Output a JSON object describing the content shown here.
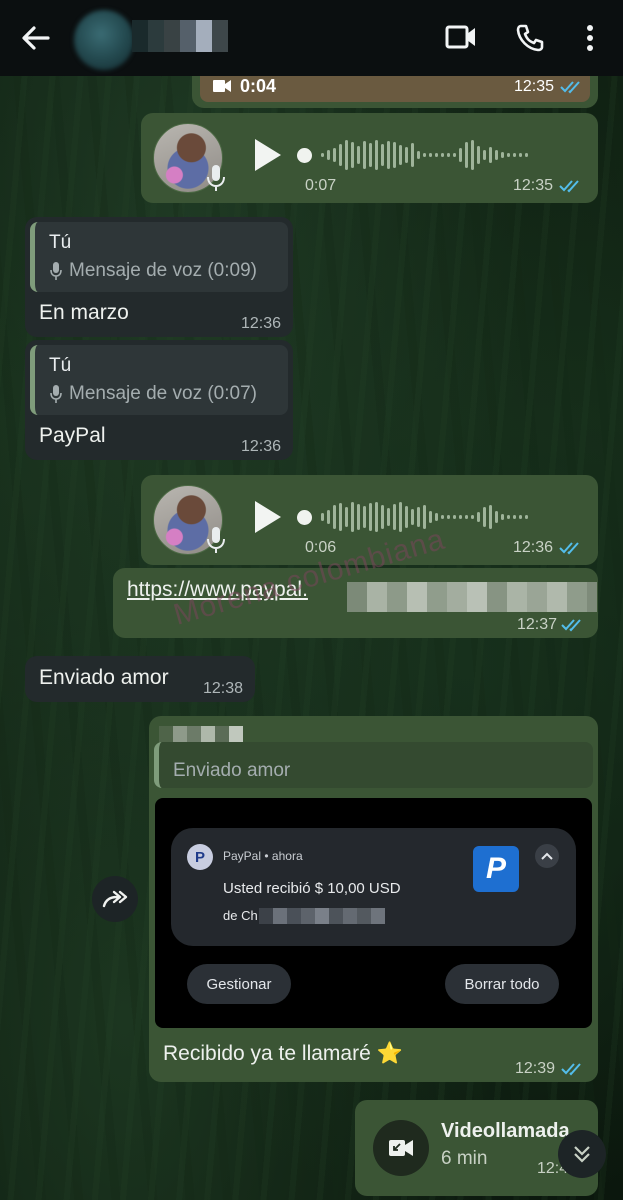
{
  "colors": {
    "outgoing_bubble": "#3b5535",
    "incoming_bubble": "#232a2c",
    "header_bg": "#0b0f10",
    "read_ticks": "#53bdeb"
  },
  "header": {
    "back_icon": "arrow-left-icon",
    "video_call_icon": "videocam-icon",
    "voice_call_icon": "phone-icon",
    "menu_icon": "more-vertical-icon"
  },
  "messages": {
    "video_clip": {
      "duration": "0:04",
      "time": "12:35"
    },
    "voice1": {
      "duration": "0:07",
      "time": "12:35"
    },
    "reply1": {
      "quote_author": "Tú",
      "quote_body": "Mensaje de voz (0:09)",
      "text": "En marzo",
      "time": "12:36"
    },
    "reply2": {
      "quote_author": "Tú",
      "quote_body": "Mensaje de voz (0:07)",
      "text": "PayPal",
      "time": "12:36"
    },
    "voice2": {
      "duration": "0:06",
      "time": "12:36"
    },
    "link": {
      "text": "https://www.paypal.",
      "time": "12:37"
    },
    "in_text": {
      "text": "Enviado amor",
      "time": "12:38"
    },
    "image_reply": {
      "quote_body": "Enviado amor",
      "notification": {
        "app": "PayPal",
        "separator": "•",
        "when": "ahora",
        "title": "Usted recibió $ 10,00 USD",
        "from_prefix": "de Ch",
        "button_manage": "Gestionar",
        "button_clear": "Borrar todo"
      },
      "caption": "Recibido ya te llamaré ⭐",
      "time": "12:39"
    },
    "video_call": {
      "title": "Videollamada",
      "duration": "6 min",
      "time": "12:4"
    }
  },
  "watermark": "Morena colombiana"
}
